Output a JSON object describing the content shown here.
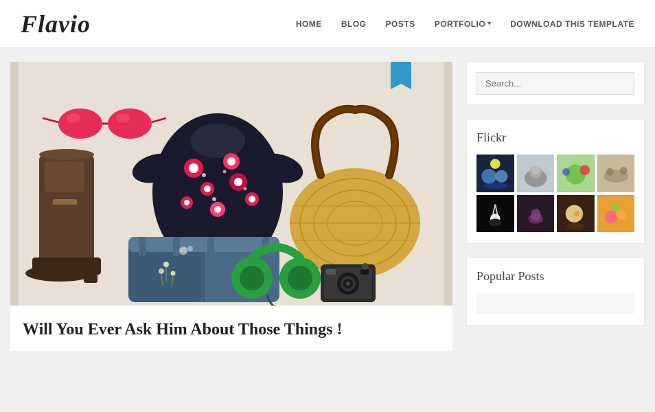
{
  "site": {
    "logo": "Flavio"
  },
  "nav": {
    "items": [
      {
        "label": "HOME",
        "href": "#"
      },
      {
        "label": "BLOG",
        "href": "#"
      },
      {
        "label": "POSTS",
        "href": "#"
      },
      {
        "label": "PORTFOLIO",
        "href": "#",
        "hasDropdown": true
      },
      {
        "label": "DOWNLOAD THIS TEMPLATE",
        "href": "#"
      }
    ]
  },
  "post": {
    "title": "Will You Ever Ask Him About Those Things !",
    "imageAlt": "Fashion flat lay with boots, floral top, denim shorts, straw bag, sunglasses, headphones and camera"
  },
  "sidebar": {
    "search": {
      "placeholder": "Search..."
    },
    "flickr": {
      "title": "Flickr"
    },
    "popularPosts": {
      "title": "Popular Posts"
    }
  }
}
